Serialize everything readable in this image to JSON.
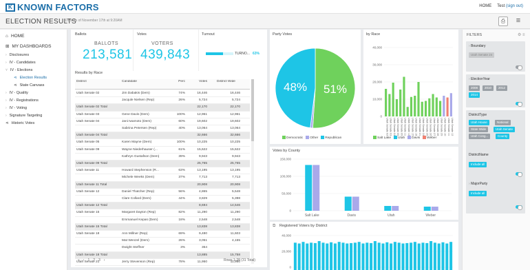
{
  "header": {
    "brand": "KNOWN FACTORS",
    "nav": {
      "home": "HOME",
      "user": "Test",
      "signout": "(sign out)"
    }
  },
  "subheader": {
    "title": "ELECTION RESULTS",
    "asof": "Data as of November 17th at 9:20AM"
  },
  "sidebar": {
    "home": "HOME",
    "dashboards": "MY DASHBOARDS",
    "items": [
      "Disclosures",
      "IV - Candidates",
      "IV - Elections",
      "Election Results",
      "State Canvass",
      "IV - Quality",
      "IV - Registrations",
      "IV - Voting",
      "Signature Targeting",
      "Historic Votes"
    ]
  },
  "ballots": {
    "label": "Ballots",
    "caption": "BALLOTS",
    "value": "213,581"
  },
  "votes": {
    "label": "Votes",
    "caption": "VOTERS",
    "value": "439,843"
  },
  "turnout": {
    "label": "Turnout",
    "caption": "TURNO...",
    "pct": "63%",
    "level": 0.63
  },
  "results": {
    "title": "Results by Race",
    "columns": [
      "District",
      "Candidate",
      "Perc",
      "Votes",
      "District Wide"
    ],
    "rows": [
      {
        "t": "r",
        "d": "Utah Senate 02",
        "n": "Jim Dabakis (Dem)",
        "p": "74%",
        "v": "16,446",
        "w": "16,446"
      },
      {
        "t": "r",
        "d": "",
        "n": "Jacqule Nielsen (Rep)",
        "p": "26%",
        "v": "5,724",
        "w": "5,724"
      },
      {
        "t": "t",
        "d": "Utah Senate 02 Total",
        "n": "",
        "p": "",
        "v": "22,170",
        "w": "22,170"
      },
      {
        "t": "r",
        "d": "Utah Senate 03",
        "n": "Gene Davis (Dem)",
        "p": "100%",
        "v": "12,961",
        "w": "12,961"
      },
      {
        "t": "r",
        "d": "Utah Senate 04",
        "n": "Jani Iwamoto (Dem)",
        "p": "60%",
        "v": "19,602",
        "w": "19,602"
      },
      {
        "t": "r",
        "d": "",
        "n": "Sabrina Petersen (Rep)",
        "p": "40%",
        "v": "13,064",
        "w": "13,064"
      },
      {
        "t": "t",
        "d": "Utah Senate 04 Total",
        "n": "",
        "p": "",
        "v": "32,666",
        "w": "32,666"
      },
      {
        "t": "r",
        "d": "Utah Senate 05",
        "n": "Karen Mayne (Dem)",
        "p": "100%",
        "v": "10,225",
        "w": "10,225"
      },
      {
        "t": "r",
        "d": "Utah Senate 09",
        "n": "Wayne Niederhauser (...",
        "p": "61%",
        "v": "15,622",
        "w": "15,622"
      },
      {
        "t": "r",
        "d": "",
        "n": "Kathryn Gustafson (Dem)",
        "p": "39%",
        "v": "9,943",
        "w": "9,943"
      },
      {
        "t": "t",
        "d": "Utah Senate 09 Total",
        "n": "",
        "p": "",
        "v": "25,765",
        "w": "25,765"
      },
      {
        "t": "r",
        "d": "Utah Senate 11",
        "n": "Howard Stephenson (R...",
        "p": "63%",
        "v": "13,195",
        "w": "13,195"
      },
      {
        "t": "r",
        "d": "",
        "n": "Michele Weeks (Dem)",
        "p": "37%",
        "v": "7,713",
        "w": "7,713"
      },
      {
        "t": "t",
        "d": "Utah Senate 11 Total",
        "n": "",
        "p": "",
        "v": "20,908",
        "w": "20,908"
      },
      {
        "t": "r",
        "d": "Utah Senate 12",
        "n": "Daniel Thatcher (Rep)",
        "p": "56%",
        "v": "4,865",
        "w": "5,548"
      },
      {
        "t": "r",
        "d": "",
        "n": "Clare Collard (Dem)",
        "p": "44%",
        "v": "3,829",
        "w": "5,398"
      },
      {
        "t": "t",
        "d": "Utah Senate 12 Total",
        "n": "",
        "p": "",
        "v": "8,694",
        "w": "14,546"
      },
      {
        "t": "r",
        "d": "Utah Senate 15",
        "n": "Margaret Dayton (Rep)",
        "p": "82%",
        "v": "11,290",
        "w": "11,290"
      },
      {
        "t": "r",
        "d": "",
        "n": "Emmanuel Kepas (Dem)",
        "p": "18%",
        "v": "2,548",
        "w": "2,548"
      },
      {
        "t": "t",
        "d": "Utah Senate 15 Total",
        "n": "",
        "p": "",
        "v": "13,838",
        "w": "13,838"
      },
      {
        "t": "r",
        "d": "Utah Senate 18",
        "n": "Ann Millner (Rep)",
        "p": "69%",
        "v": "9,480",
        "w": "11,603"
      },
      {
        "t": "r",
        "d": "",
        "n": "Mat Wenzel (Dem)",
        "p": "26%",
        "v": "3,051",
        "w": "4,155"
      },
      {
        "t": "r",
        "d": "",
        "n": "Dwight Steffner",
        "p": "3%",
        "v": "354",
        "w": ""
      },
      {
        "t": "t",
        "d": "Utah Senate 18 Total",
        "n": "",
        "p": "",
        "v": "13,885",
        "w": "15,758"
      },
      {
        "t": "r",
        "d": "Utah Senate 21",
        "n": "Jerry Stevenson (Rep)",
        "p": "78%",
        "v": "11,950",
        "w": "11,950"
      }
    ],
    "pager": [
      "«",
      "‹",
      "1",
      "2",
      "3",
      "›"
    ],
    "count": "Rows 1-28 (31 Total)"
  },
  "party_votes": {
    "title": "Party Votes"
  },
  "by_race": {
    "title": "by Race"
  },
  "votes_by_county": {
    "title": "Votes by County"
  },
  "registered": {
    "title": "Registered Voters by District"
  },
  "filters": {
    "title": "FILTERS",
    "boundary": {
      "label": "Boundary",
      "value": "Utah Senate 24"
    },
    "election_year": {
      "label": "ElectionYear",
      "chips": [
        "2008",
        "2010",
        "2012",
        "2014"
      ],
      "selected": "2014"
    },
    "district_type": {
      "label": "DistrictType",
      "chips": [
        "Utah House",
        "National",
        "State Wide",
        "Utah Senate",
        "Utah Cong...",
        "County"
      ],
      "selected": [
        "Utah House",
        "Utah Senate",
        "County"
      ]
    },
    "district_name": {
      "label": "DistrictName",
      "value": "Include all"
    },
    "major_party": {
      "label": "MajorParty",
      "value": "Include all"
    }
  },
  "chart_data": [
    {
      "type": "pie",
      "title": "Party Votes",
      "labels": [
        "Democratic",
        "Other",
        "Republican"
      ],
      "values": [
        51,
        1,
        48
      ],
      "data_labels": [
        "51%",
        "",
        "48%"
      ],
      "colors": [
        "#6fd15c",
        "#a9a9ea",
        "#1ec5e6"
      ],
      "legend": "bottom"
    },
    {
      "type": "bar",
      "title": "by Race",
      "ylim": [
        0,
        40000
      ],
      "yticks": [
        "0",
        "10,000",
        "20,000",
        "30,000",
        "40,000"
      ],
      "categories": [
        "Utah Senate 02",
        "Utah Senate 03",
        "Utah Senate 04",
        "Utah Senate 05",
        "Utah Senate 09",
        "Utah Senate 11",
        "Utah Senate 12",
        "Utah Senate 15",
        "Utah Senate 18",
        "Utah Senate 21",
        "Utah Senate 24",
        "Utah Senate 25",
        "Utah Senate 26",
        "Utah Senate 27",
        "Utah Senate 28",
        "Utah Senate 29",
        "Utah Senate 10",
        "Utah Senate 11",
        "Utah Senate 12"
      ],
      "series": [
        {
          "name": "Salt Lake",
          "color": "#6fd15c",
          "values": [
            16000,
            13000,
            19600,
            10000,
            15600,
            23000,
            5500,
            11300,
            12000,
            20000,
            8500,
            9000,
            10500,
            13000,
            11000,
            9000,
            0,
            0,
            0
          ]
        },
        {
          "name": "Utah",
          "color": "#1ec5e6",
          "values": [
            0,
            0,
            0,
            0,
            0,
            0,
            0,
            0,
            0,
            0,
            0,
            0,
            0,
            0,
            0,
            0,
            0,
            0,
            0
          ]
        },
        {
          "name": "Davis",
          "color": "#a9a9ea",
          "values": [
            0,
            0,
            0,
            0,
            0,
            0,
            0,
            0,
            0,
            0,
            0,
            0,
            0,
            0,
            0,
            0,
            12000,
            0,
            13500
          ]
        },
        {
          "name": "Weber",
          "color": "#f08070",
          "values": [
            0,
            0,
            0,
            0,
            0,
            0,
            0,
            0,
            0,
            0,
            0,
            0,
            0,
            0,
            0,
            0,
            0,
            11000,
            0
          ]
        }
      ],
      "legend": "bottom"
    },
    {
      "type": "bar",
      "title": "Votes by County",
      "ylim": [
        0,
        150000
      ],
      "yticks": [
        "0",
        "50,000",
        "100,000",
        "150,000"
      ],
      "categories": [
        "Salt Lake",
        "Davis",
        "Utah",
        "Weber"
      ],
      "series": [
        {
          "color": "#1ec5e6",
          "values": [
            133000,
            41000,
            14000,
            12000
          ]
        },
        {
          "color": "#a9a9ea",
          "values": [
            133000,
            41000,
            14000,
            12000
          ]
        }
      ]
    },
    {
      "type": "bar",
      "title": "Registered Voters by District",
      "ylim": [
        0,
        40000
      ],
      "yticks": [
        "0",
        "20,000",
        "40,000"
      ],
      "values": [
        31000,
        30000,
        32000,
        30000,
        31000,
        30500,
        33000,
        31000,
        30000,
        31500,
        30000,
        32000,
        31000,
        30000,
        30500,
        31000,
        32000,
        30000,
        31000,
        30500,
        33000,
        31000,
        30000,
        31500,
        30000,
        32000,
        31000,
        30000,
        30500,
        31000,
        32000,
        30000,
        31000,
        30500,
        33000,
        31000,
        30000,
        31500,
        30000,
        32000
      ],
      "color": "#1ec5e6"
    }
  ]
}
